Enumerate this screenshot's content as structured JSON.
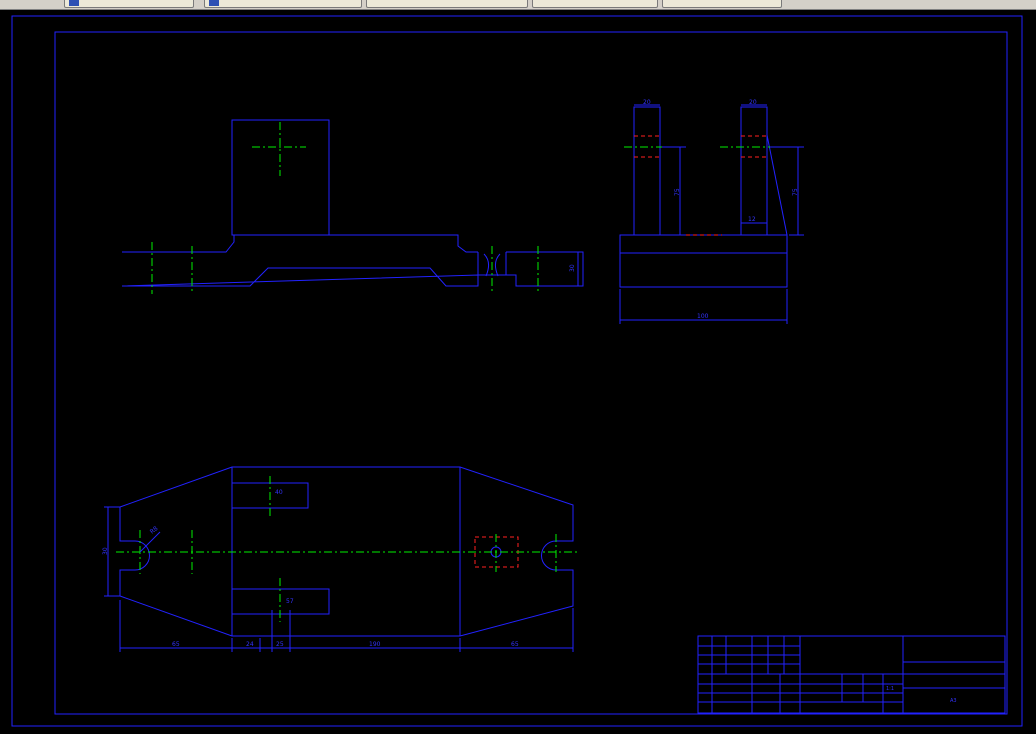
{
  "taskbar": {
    "tabs": [
      "",
      "",
      "",
      "",
      "",
      ""
    ]
  },
  "drawing": {
    "front_view": {
      "height_dim": "30"
    },
    "side_view": {
      "left_top_dim": "20",
      "right_top_dim": "20",
      "left_height_dim": "75",
      "right_height_dim": "75",
      "small_dim": "12",
      "base_width_dim": "100"
    },
    "plan_view": {
      "slot_top_dim": "40",
      "slot_bottom_dim": "57",
      "radius_dim": "R8",
      "left_height_dim": "30",
      "bottom_dims": [
        "65",
        "24",
        "25",
        "190",
        "65"
      ]
    },
    "title_block": {
      "drawing_name": "",
      "scale": "1:1",
      "format": "A3"
    }
  },
  "colors": {
    "background": "#000000",
    "geometry": "#2222ff",
    "centerline": "#00ee00",
    "hidden": "#ff2020"
  }
}
